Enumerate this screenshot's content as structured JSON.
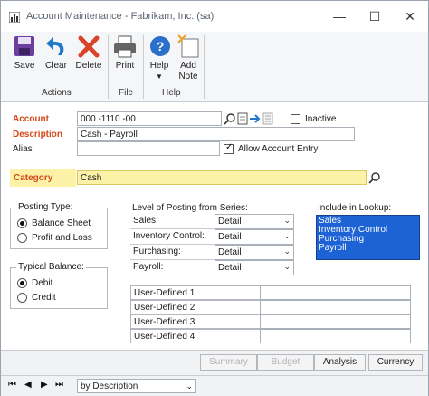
{
  "window": {
    "title": "Account Maintenance  -  Fabrikam, Inc. (sa)"
  },
  "toolbar": {
    "save": "Save",
    "clear": "Clear",
    "delete": "Delete",
    "print": "Print",
    "help": "Help",
    "add_note_1": "Add",
    "add_note_2": "Note",
    "group_actions": "Actions",
    "group_file": "File",
    "group_help": "Help"
  },
  "form": {
    "account_label": "Account",
    "account_value": "000  -1110 -00",
    "inactive_label": "Inactive",
    "inactive_checked": false,
    "description_label": "Description",
    "description_value": "Cash - Payroll",
    "alias_label": "Alias",
    "alias_value": "",
    "allow_entry_label": "Allow Account Entry",
    "allow_entry_checked": true,
    "category_label": "Category",
    "category_value": "Cash"
  },
  "posting_type": {
    "title": "Posting Type:",
    "options": [
      "Balance Sheet",
      "Profit and Loss"
    ],
    "selected": "Balance Sheet"
  },
  "typical_balance": {
    "title": "Typical Balance:",
    "options": [
      "Debit",
      "Credit"
    ],
    "selected": "Debit"
  },
  "posting_series": {
    "title": "Level of Posting from Series:",
    "rows": [
      {
        "label": "Sales:",
        "value": "Detail"
      },
      {
        "label": "Inventory Control:",
        "value": "Detail"
      },
      {
        "label": "Purchasing:",
        "value": "Detail"
      },
      {
        "label": "Payroll:",
        "value": "Detail"
      }
    ]
  },
  "lookup": {
    "title": "Include in Lookup:",
    "items": [
      "Sales",
      "Inventory Control",
      "Purchasing",
      "Payroll"
    ]
  },
  "user_defined": [
    "User-Defined 1",
    "User-Defined 2",
    "User-Defined 3",
    "User-Defined 4"
  ],
  "buttons": {
    "summary": "Summary",
    "budget": "Budget",
    "analysis": "Analysis",
    "currency": "Currency"
  },
  "browse": {
    "sort_by": "by Description"
  }
}
